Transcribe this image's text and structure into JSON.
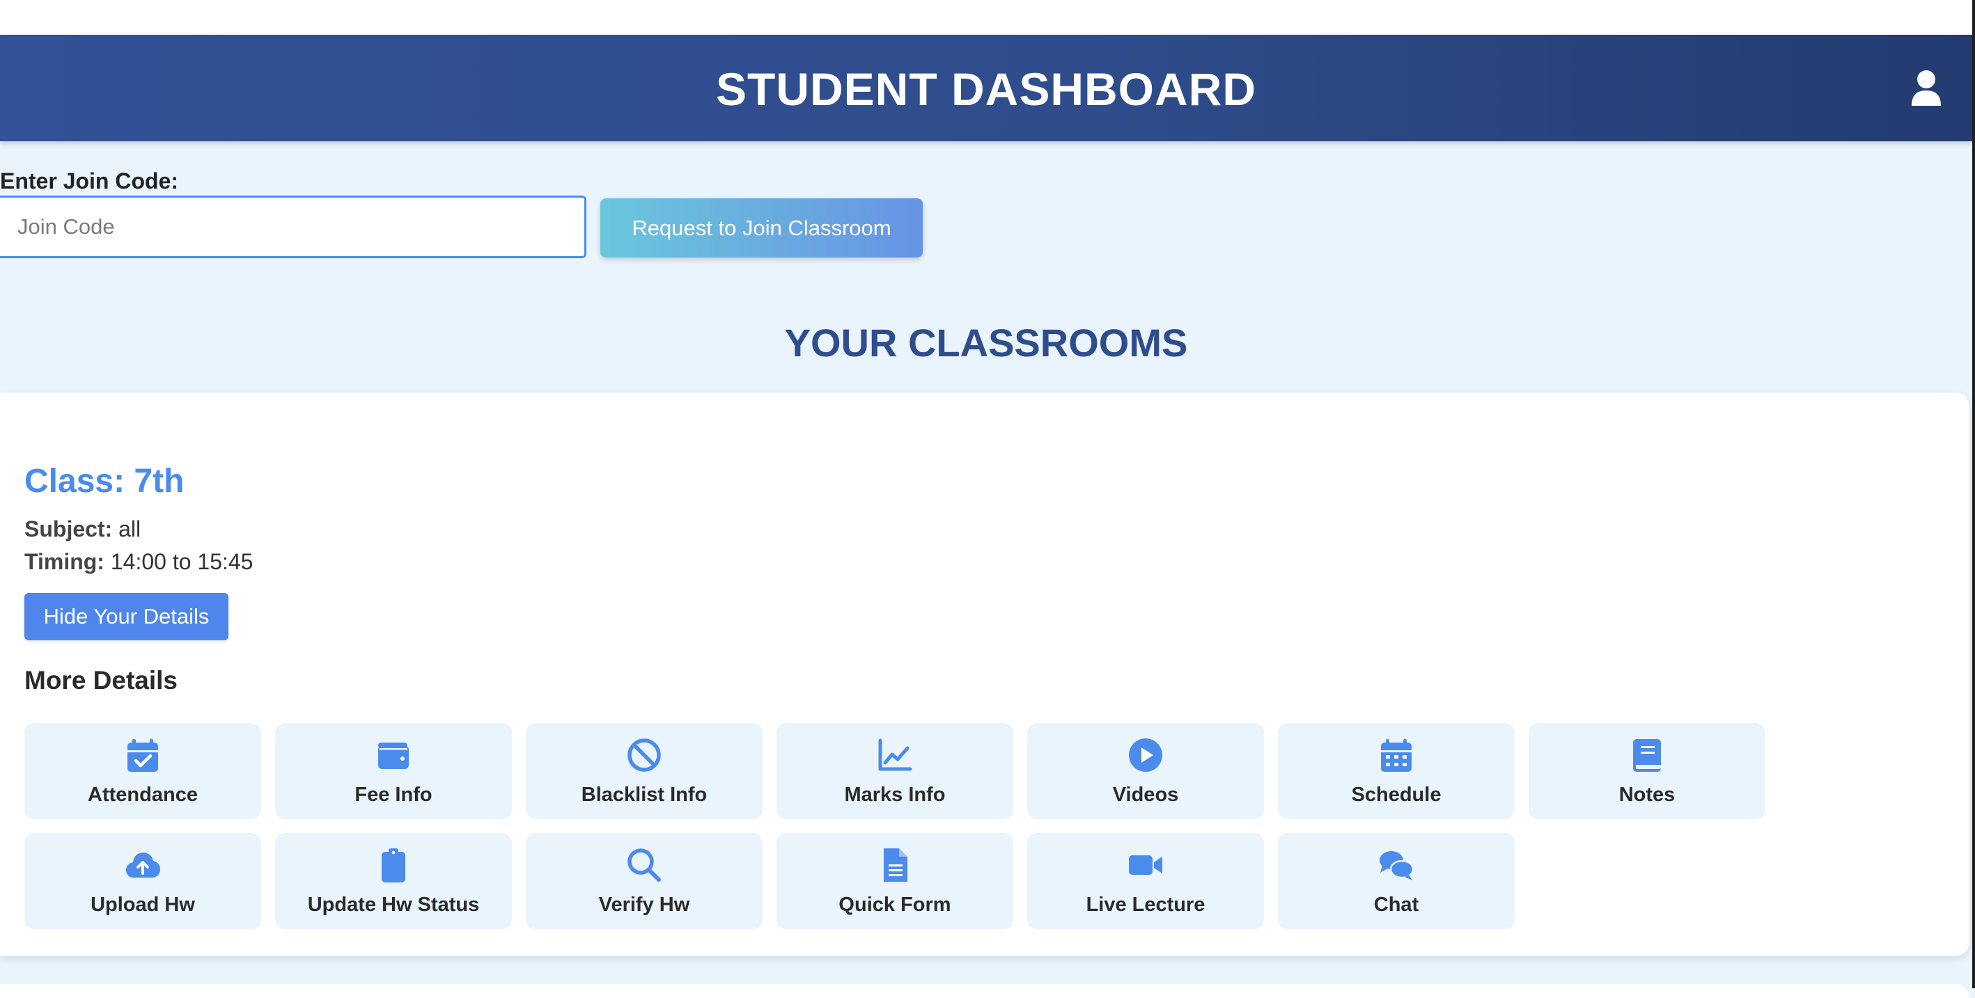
{
  "header": {
    "title": "STUDENT DASHBOARD",
    "profile_icon": "user-icon"
  },
  "join": {
    "label": "Enter Join Code:",
    "input_value": "",
    "input_placeholder": "Join Code",
    "button_label": "Request to Join Classroom"
  },
  "classrooms": {
    "section_title": "YOUR CLASSROOMS",
    "card": {
      "class_title": "Class: 7th",
      "subject_label": "Subject:",
      "subject_value": "all",
      "timing_label": "Timing:",
      "timing_value": "14:00 to 15:45",
      "hide_button": "Hide Your Details",
      "more_title": "More Details",
      "tiles": [
        {
          "label": "Attendance",
          "icon": "calendar-check-icon"
        },
        {
          "label": "Fee Info",
          "icon": "wallet-icon"
        },
        {
          "label": "Blacklist Info",
          "icon": "ban-icon"
        },
        {
          "label": "Marks Info",
          "icon": "line-chart-icon"
        },
        {
          "label": "Videos",
          "icon": "play-circle-icon"
        },
        {
          "label": "Schedule",
          "icon": "calendar-icon"
        },
        {
          "label": "Notes",
          "icon": "book-icon"
        },
        {
          "label": "Upload Hw",
          "icon": "cloud-upload-icon"
        },
        {
          "label": "Update Hw Status",
          "icon": "clipboard-icon"
        },
        {
          "label": "Verify Hw",
          "icon": "magnifier-icon"
        },
        {
          "label": "Quick Form",
          "icon": "document-icon"
        },
        {
          "label": "Live Lecture",
          "icon": "video-camera-icon"
        },
        {
          "label": "Chat",
          "icon": "chat-bubbles-icon"
        }
      ]
    }
  },
  "colors": {
    "header": "#2f4d8c",
    "accent": "#4a8bec",
    "page_bg": "#eaf4fd"
  }
}
